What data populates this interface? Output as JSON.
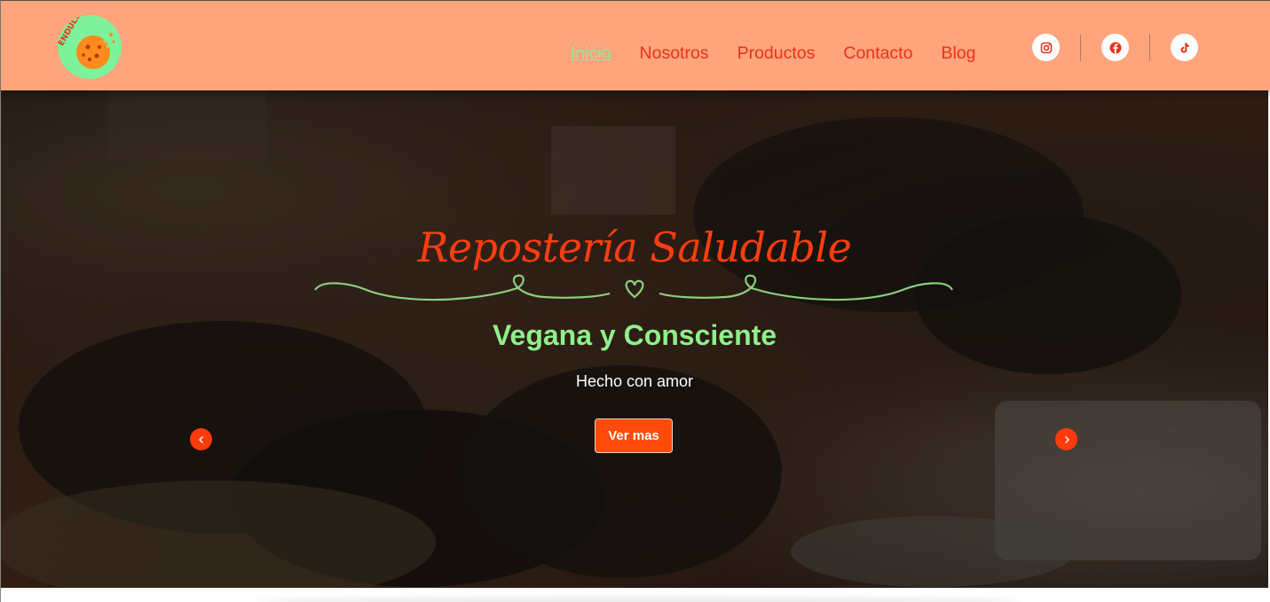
{
  "logo": {
    "text": "ENDULSANA",
    "icon": "cookie-icon"
  },
  "nav": {
    "items": [
      {
        "label": "Inicio",
        "active": true
      },
      {
        "label": "Nosotros",
        "active": false
      },
      {
        "label": "Productos",
        "active": false
      },
      {
        "label": "Contacto",
        "active": false
      },
      {
        "label": "Blog",
        "active": false
      }
    ]
  },
  "social": [
    "instagram-icon",
    "facebook-icon",
    "tiktok-icon"
  ],
  "hero": {
    "title": "Repostería Saludable",
    "subtitle": "Vegana y Consciente",
    "tagline": "Hecho con amor",
    "cta_label": "Ver mas",
    "prev_icon": "chevron-left-icon",
    "next_icon": "chevron-right-icon"
  },
  "colors": {
    "header_bg": "#ffa47c",
    "nav_text": "#e8331a",
    "nav_active": "#7ef29a",
    "accent_orange": "#ff4a0c",
    "title_red": "#ff3d10",
    "subtitle_green": "#8ff08a"
  }
}
